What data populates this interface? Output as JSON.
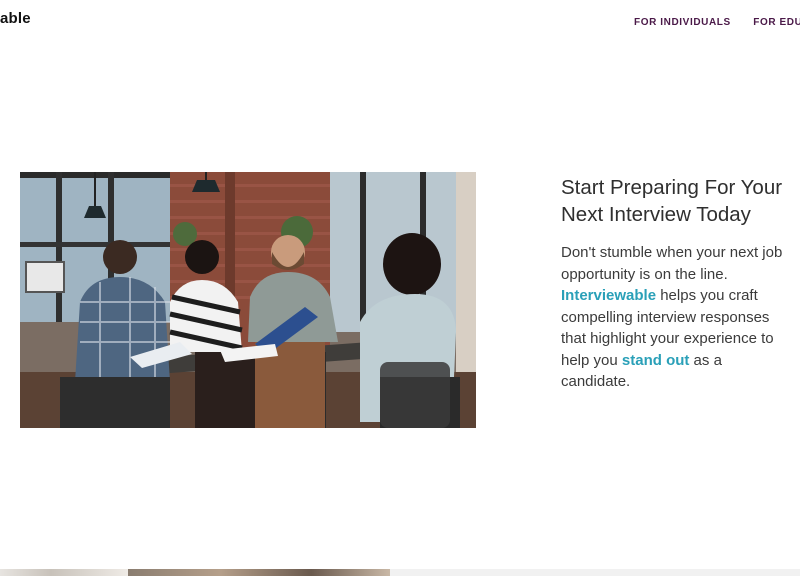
{
  "header": {
    "brand": "able",
    "nav": [
      {
        "label": "FOR INDIVIDUALS"
      },
      {
        "label": "FOR EDUC"
      }
    ]
  },
  "hero": {
    "image_alt": "Four people meeting around a table in an office",
    "title": "Start Preparing For Your Next Interview Today",
    "body": {
      "part1": "Don't stumble when your next job opportunity is on the line. ",
      "brand_highlight": "Interviewable",
      "part2": " helps you craft compelling interview responses that highlight your experience to help you ",
      "highlight": "stand out",
      "part3": " as a candidate."
    }
  },
  "colors": {
    "nav_text": "#4a1948",
    "highlight": "#2aa0b8",
    "heading": "#2f2f2f"
  }
}
